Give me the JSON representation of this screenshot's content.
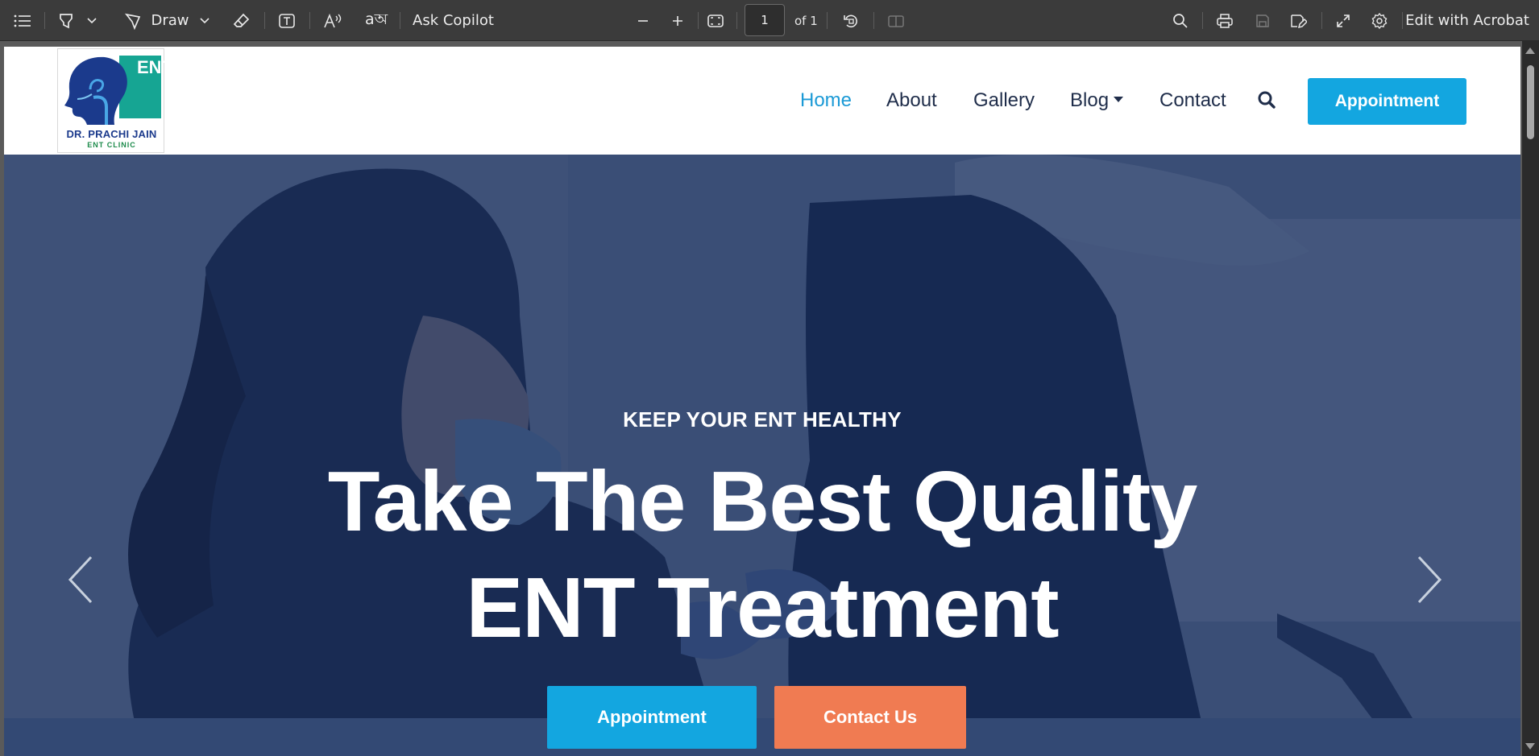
{
  "toolbar": {
    "draw_label": "Draw",
    "ask_copilot_label": "Ask Copilot",
    "page_current": "1",
    "page_of": "of 1",
    "edit_acrobat_label": "Edit with Acrobat",
    "icons": [
      "contents-icon",
      "highlight-icon",
      "chevron-down-icon",
      "draw-icon",
      "chevron-down-icon",
      "eraser-icon",
      "text-box-icon",
      "read-aloud-icon",
      "translate-icon",
      "zoom-out-icon",
      "zoom-in-icon",
      "fit-page-icon",
      "rotate-icon",
      "page-view-icon",
      "search-icon",
      "print-icon",
      "save-icon",
      "save-as-icon",
      "fullscreen-icon",
      "settings-icon"
    ]
  },
  "site": {
    "logo": {
      "letters": "ENT",
      "name": "DR. PRACHI JAIN",
      "subtitle": "ENT CLINIC"
    },
    "nav": {
      "home": "Home",
      "about": "About",
      "gallery": "Gallery",
      "blog": "Blog",
      "contact": "Contact",
      "appointment": "Appointment"
    },
    "hero": {
      "kicker": "KEEP YOUR ENT HEALTHY",
      "title_line1": "Take The Best Quality",
      "title_line2": "ENT Treatment",
      "btn_appointment": "Appointment",
      "btn_contact": "Contact Us"
    }
  },
  "colors": {
    "accent_blue": "#13a6e0",
    "accent_orange": "#f07b52",
    "nav_active": "#1b9ad6",
    "nav_text": "#1f2d4a",
    "hero_overlay": "#0e2456"
  }
}
